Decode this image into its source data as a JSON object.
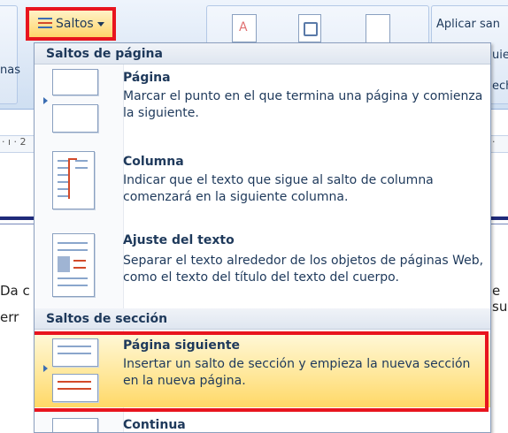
{
  "ribbon": {
    "saltos_label": "Saltos",
    "aplicar_label": "Aplicar san",
    "cut_uie": "uie",
    "cut_ech": "ech",
    "cut_inas": "nas"
  },
  "ruler": {
    "left_mark": "· ı · 2",
    "right_mark": "·"
  },
  "document": {
    "line1": "Da c",
    "line2": "err",
    "right_fragment": "e su"
  },
  "menu": {
    "section_pagina": "Saltos de página",
    "section_seccion": "Saltos de sección",
    "items": [
      {
        "title": "Página",
        "description": "Marcar el punto en el que termina una página y comienza la siguiente."
      },
      {
        "title": "Columna",
        "description": "Indicar que el texto que sigue al salto de columna comenzará en la siguiente columna."
      },
      {
        "title": "Ajuste del texto",
        "description": "Separar el texto alrededor de los objetos de páginas Web, como el texto del título del texto del cuerpo."
      },
      {
        "title": "Página siguiente",
        "description": "Insertar un salto de sección y empieza la nueva sección en la nueva página."
      },
      {
        "title": "Continua",
        "description": ""
      }
    ]
  },
  "colors": {
    "highlight": "#e8141e",
    "menu_text": "#1e395b",
    "selected_bg": "#ffe696"
  },
  "icons": [
    "page-break-icon",
    "column-break-icon",
    "text-wrap-icon",
    "next-page-section-icon",
    "continuous-section-icon",
    "breaks-icon",
    "dropdown-caret-icon"
  ]
}
